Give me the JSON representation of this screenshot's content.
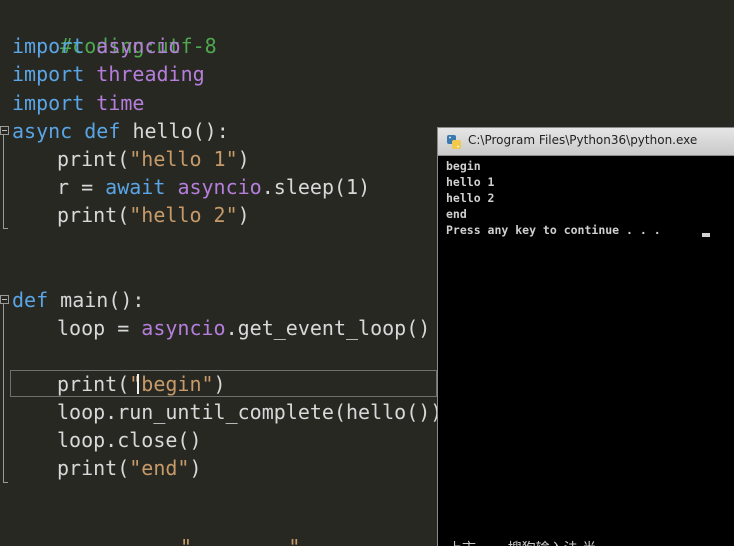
{
  "editor": {
    "lines": {
      "l1": {
        "comment": "#coding:utf-8"
      },
      "l2": {
        "kw": "import",
        "mod": "asyncio"
      },
      "l3": {
        "kw": "import",
        "mod": "threading"
      },
      "l4": {
        "kw": "import",
        "mod": "time"
      },
      "l5": {
        "kw1": "async",
        "kw2": "def",
        "rest": "hello():"
      },
      "l6": {
        "fn": "print(",
        "str": "\"hello 1\"",
        "close": ")"
      },
      "l7": {
        "a": "r = ",
        "kw": "await",
        "mod": "asyncio",
        "rest": ".sleep(1)"
      },
      "l8": {
        "fn": "print(",
        "str": "\"hello 2\"",
        "close": ")"
      },
      "l9": {
        "kw": "def",
        "rest": "main():"
      },
      "l10": {
        "a": "loop = ",
        "mod": "asyncio",
        "rest": ".get_event_loop()"
      },
      "l11": {
        "fn": "print(",
        "str": "\"begin\"",
        "close": ")"
      },
      "l12": {
        "text": "loop.run_until_complete(hello())"
      },
      "l13": {
        "text": "loop.close()"
      },
      "l14": {
        "fn": "print(",
        "str": "\"end\"",
        "close": ")"
      },
      "partial_bottom": "\"        \""
    }
  },
  "console": {
    "title": "C:\\Program Files\\Python36\\python.exe",
    "output": [
      "begin",
      "hello 1",
      "hello 2",
      "end",
      "Press any key to continue . . ."
    ],
    "garbled_bottom": "上市  …  搜狗输入法 半"
  },
  "icons": {
    "console_icon": "python-icon"
  }
}
